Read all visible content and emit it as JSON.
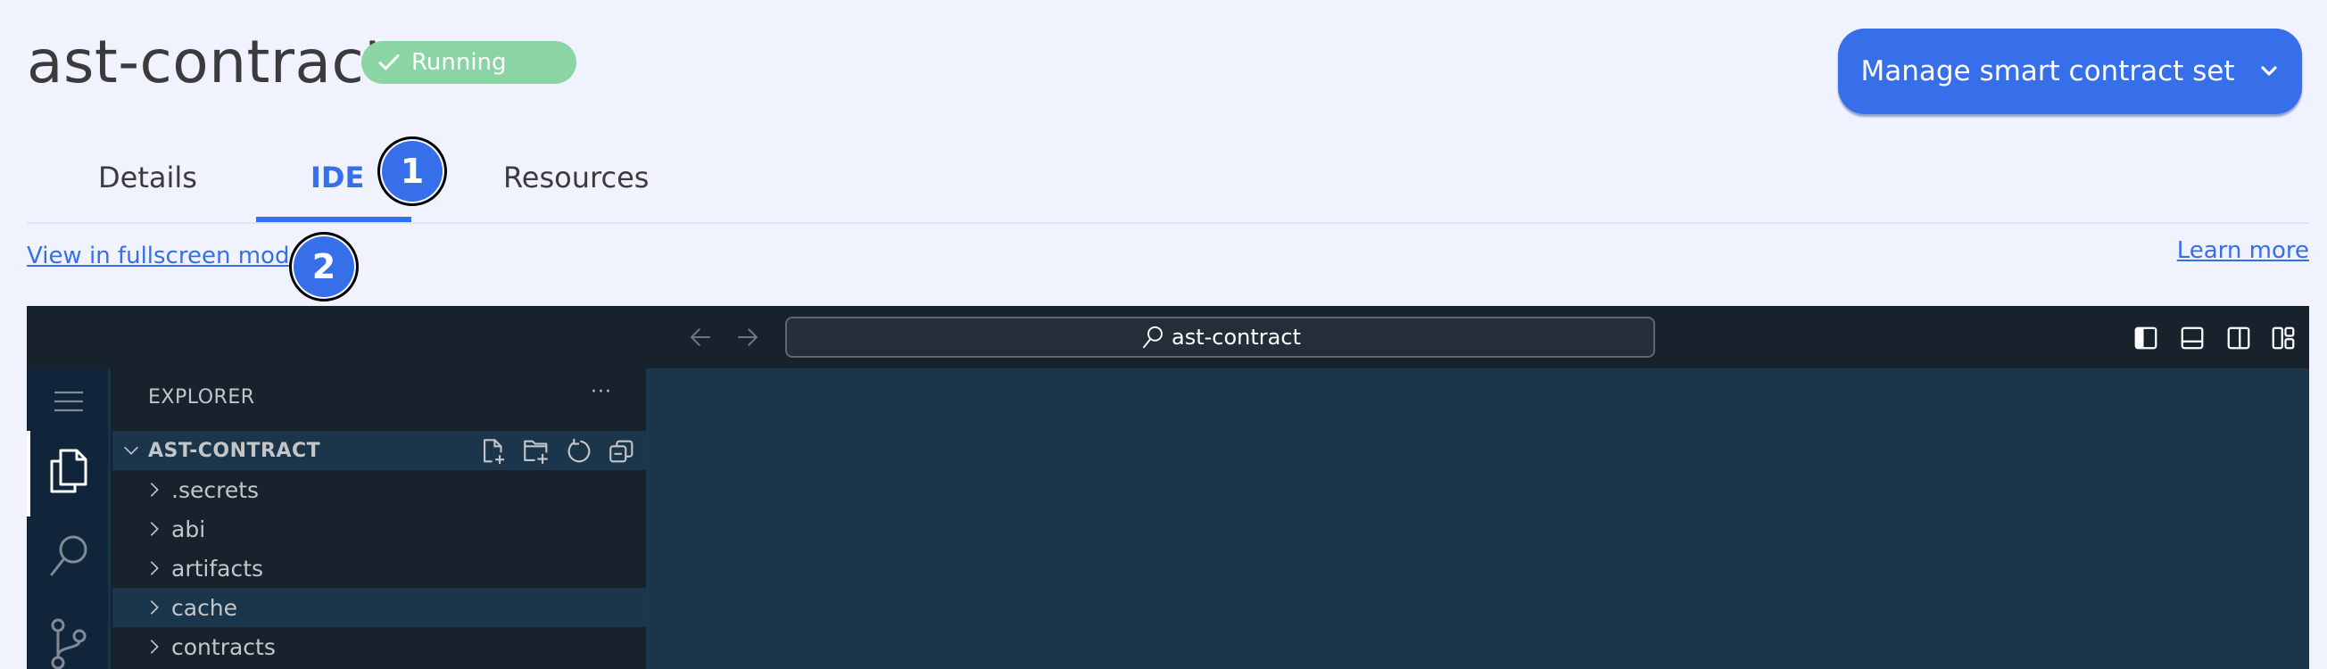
{
  "header": {
    "title": "ast-contract",
    "status": {
      "label": "Running",
      "icon": "check-icon",
      "color": "#8AD5A3"
    },
    "manage_button": {
      "label": "Manage smart contract set",
      "icon": "chevron-down-icon",
      "color": "#376FEA"
    }
  },
  "tabs": [
    {
      "label": "Details",
      "active": false
    },
    {
      "label": "IDE",
      "active": true
    },
    {
      "label": "Resources",
      "active": false
    }
  ],
  "markers": [
    "1",
    "2"
  ],
  "links": {
    "fullscreen": "View in fullscreen mode.",
    "learn_more": "Learn more"
  },
  "ide": {
    "command_center": {
      "text": "ast-contract",
      "icon": "search-icon"
    },
    "nav": {
      "back_icon": "arrow-left-icon",
      "forward_icon": "arrow-right-icon"
    },
    "layout_icons": [
      "toggle-primary-sidebar-icon",
      "toggle-panel-icon",
      "toggle-secondary-sidebar-icon",
      "customize-layout-icon"
    ],
    "activity_bar": [
      {
        "name": "menu",
        "icon": "hamburger-menu-icon"
      },
      {
        "name": "explorer",
        "icon": "files-icon",
        "active": true
      },
      {
        "name": "search",
        "icon": "search-icon"
      },
      {
        "name": "source-control",
        "icon": "source-control-icon"
      }
    ],
    "explorer": {
      "title": "EXPLORER",
      "more": "···",
      "folder": "AST-CONTRACT",
      "folder_actions": [
        "new-file-icon",
        "new-folder-icon",
        "refresh-icon",
        "collapse-all-icon"
      ],
      "items": [
        {
          "label": ".secrets",
          "selected": false
        },
        {
          "label": "abi",
          "selected": false
        },
        {
          "label": "artifacts",
          "selected": false
        },
        {
          "label": "cache",
          "selected": true
        },
        {
          "label": "contracts",
          "selected": false
        }
      ]
    }
  }
}
